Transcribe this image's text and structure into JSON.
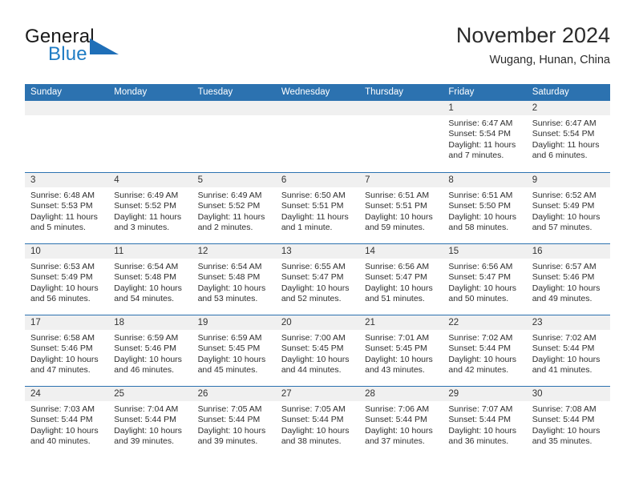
{
  "brand": {
    "word_one": "General",
    "word_two": "Blue",
    "accent_color": "#1f7cc4",
    "triangle_color": "#1f6fb8"
  },
  "header": {
    "title": "November 2024",
    "subtitle": "Wugang, Hunan, China",
    "header_bar_color": "#2c72b0"
  },
  "weekdays": [
    "Sunday",
    "Monday",
    "Tuesday",
    "Wednesday",
    "Thursday",
    "Friday",
    "Saturday"
  ],
  "weeks": [
    [
      {
        "day": "",
        "lines": []
      },
      {
        "day": "",
        "lines": []
      },
      {
        "day": "",
        "lines": []
      },
      {
        "day": "",
        "lines": []
      },
      {
        "day": "",
        "lines": []
      },
      {
        "day": "1",
        "lines": [
          "Sunrise: 6:47 AM",
          "Sunset: 5:54 PM",
          "Daylight: 11 hours",
          "and 7 minutes."
        ]
      },
      {
        "day": "2",
        "lines": [
          "Sunrise: 6:47 AM",
          "Sunset: 5:54 PM",
          "Daylight: 11 hours",
          "and 6 minutes."
        ]
      }
    ],
    [
      {
        "day": "3",
        "lines": [
          "Sunrise: 6:48 AM",
          "Sunset: 5:53 PM",
          "Daylight: 11 hours",
          "and 5 minutes."
        ]
      },
      {
        "day": "4",
        "lines": [
          "Sunrise: 6:49 AM",
          "Sunset: 5:52 PM",
          "Daylight: 11 hours",
          "and 3 minutes."
        ]
      },
      {
        "day": "5",
        "lines": [
          "Sunrise: 6:49 AM",
          "Sunset: 5:52 PM",
          "Daylight: 11 hours",
          "and 2 minutes."
        ]
      },
      {
        "day": "6",
        "lines": [
          "Sunrise: 6:50 AM",
          "Sunset: 5:51 PM",
          "Daylight: 11 hours",
          "and 1 minute."
        ]
      },
      {
        "day": "7",
        "lines": [
          "Sunrise: 6:51 AM",
          "Sunset: 5:51 PM",
          "Daylight: 10 hours",
          "and 59 minutes."
        ]
      },
      {
        "day": "8",
        "lines": [
          "Sunrise: 6:51 AM",
          "Sunset: 5:50 PM",
          "Daylight: 10 hours",
          "and 58 minutes."
        ]
      },
      {
        "day": "9",
        "lines": [
          "Sunrise: 6:52 AM",
          "Sunset: 5:49 PM",
          "Daylight: 10 hours",
          "and 57 minutes."
        ]
      }
    ],
    [
      {
        "day": "10",
        "lines": [
          "Sunrise: 6:53 AM",
          "Sunset: 5:49 PM",
          "Daylight: 10 hours",
          "and 56 minutes."
        ]
      },
      {
        "day": "11",
        "lines": [
          "Sunrise: 6:54 AM",
          "Sunset: 5:48 PM",
          "Daylight: 10 hours",
          "and 54 minutes."
        ]
      },
      {
        "day": "12",
        "lines": [
          "Sunrise: 6:54 AM",
          "Sunset: 5:48 PM",
          "Daylight: 10 hours",
          "and 53 minutes."
        ]
      },
      {
        "day": "13",
        "lines": [
          "Sunrise: 6:55 AM",
          "Sunset: 5:47 PM",
          "Daylight: 10 hours",
          "and 52 minutes."
        ]
      },
      {
        "day": "14",
        "lines": [
          "Sunrise: 6:56 AM",
          "Sunset: 5:47 PM",
          "Daylight: 10 hours",
          "and 51 minutes."
        ]
      },
      {
        "day": "15",
        "lines": [
          "Sunrise: 6:56 AM",
          "Sunset: 5:47 PM",
          "Daylight: 10 hours",
          "and 50 minutes."
        ]
      },
      {
        "day": "16",
        "lines": [
          "Sunrise: 6:57 AM",
          "Sunset: 5:46 PM",
          "Daylight: 10 hours",
          "and 49 minutes."
        ]
      }
    ],
    [
      {
        "day": "17",
        "lines": [
          "Sunrise: 6:58 AM",
          "Sunset: 5:46 PM",
          "Daylight: 10 hours",
          "and 47 minutes."
        ]
      },
      {
        "day": "18",
        "lines": [
          "Sunrise: 6:59 AM",
          "Sunset: 5:46 PM",
          "Daylight: 10 hours",
          "and 46 minutes."
        ]
      },
      {
        "day": "19",
        "lines": [
          "Sunrise: 6:59 AM",
          "Sunset: 5:45 PM",
          "Daylight: 10 hours",
          "and 45 minutes."
        ]
      },
      {
        "day": "20",
        "lines": [
          "Sunrise: 7:00 AM",
          "Sunset: 5:45 PM",
          "Daylight: 10 hours",
          "and 44 minutes."
        ]
      },
      {
        "day": "21",
        "lines": [
          "Sunrise: 7:01 AM",
          "Sunset: 5:45 PM",
          "Daylight: 10 hours",
          "and 43 minutes."
        ]
      },
      {
        "day": "22",
        "lines": [
          "Sunrise: 7:02 AM",
          "Sunset: 5:44 PM",
          "Daylight: 10 hours",
          "and 42 minutes."
        ]
      },
      {
        "day": "23",
        "lines": [
          "Sunrise: 7:02 AM",
          "Sunset: 5:44 PM",
          "Daylight: 10 hours",
          "and 41 minutes."
        ]
      }
    ],
    [
      {
        "day": "24",
        "lines": [
          "Sunrise: 7:03 AM",
          "Sunset: 5:44 PM",
          "Daylight: 10 hours",
          "and 40 minutes."
        ]
      },
      {
        "day": "25",
        "lines": [
          "Sunrise: 7:04 AM",
          "Sunset: 5:44 PM",
          "Daylight: 10 hours",
          "and 39 minutes."
        ]
      },
      {
        "day": "26",
        "lines": [
          "Sunrise: 7:05 AM",
          "Sunset: 5:44 PM",
          "Daylight: 10 hours",
          "and 39 minutes."
        ]
      },
      {
        "day": "27",
        "lines": [
          "Sunrise: 7:05 AM",
          "Sunset: 5:44 PM",
          "Daylight: 10 hours",
          "and 38 minutes."
        ]
      },
      {
        "day": "28",
        "lines": [
          "Sunrise: 7:06 AM",
          "Sunset: 5:44 PM",
          "Daylight: 10 hours",
          "and 37 minutes."
        ]
      },
      {
        "day": "29",
        "lines": [
          "Sunrise: 7:07 AM",
          "Sunset: 5:44 PM",
          "Daylight: 10 hours",
          "and 36 minutes."
        ]
      },
      {
        "day": "30",
        "lines": [
          "Sunrise: 7:08 AM",
          "Sunset: 5:44 PM",
          "Daylight: 10 hours",
          "and 35 minutes."
        ]
      }
    ]
  ]
}
